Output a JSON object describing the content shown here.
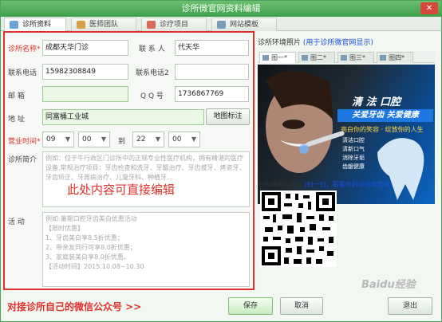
{
  "window": {
    "title": "诊所微官网资料编辑",
    "close_label": "✕"
  },
  "tabs": [
    {
      "label": "诊所资料",
      "active": true,
      "icon": "clinic-icon"
    },
    {
      "label": "医师团队",
      "active": false,
      "icon": "team-icon"
    },
    {
      "label": "诊疗项目",
      "active": false,
      "icon": "project-icon"
    },
    {
      "label": "网站模板",
      "active": false,
      "icon": "template-icon"
    }
  ],
  "form": {
    "clinic_name_label": "诊所名称*",
    "clinic_name_value": "成都天华门诊",
    "contact_label": "联 系 人",
    "contact_value": "代天华",
    "phone_label": "联系电话",
    "phone_value": "15982308849",
    "phone2_label": "联系电话2",
    "phone2_value": "",
    "mail_label": "邮    箱",
    "mail_value": "",
    "qq_label": "Q Q 号",
    "qq_value": "1736867769",
    "address_label": "地    址",
    "address_value": "同富桶工业城",
    "map_button": "地图标注",
    "hours_label": "营业时间*",
    "hour_start": "09",
    "min_start": "00",
    "to_label": "到",
    "hour_end": "22",
    "min_end": "00",
    "intro_label": "诊所简介",
    "intro_placeholder": "例如：位于牛行政区门诊所中的正规专业性医疗机构，拥有精湛的医疗设备,常规治疗项目：牙齿检查和洗牙、牙髓治疗、牙齿拔牙、烤瓷牙、牙齿矫正、牙周病治疗、儿童牙科、种植牙…",
    "overlay_note": "此处内容可直接编辑",
    "activity_label": "活    动",
    "activity_placeholder": "例如:暑期口腔牙齿美白优惠活动\n【限时优惠】\n1、牙齿美白享8.5折优惠；\n2、带亲友同行可享8.0折优惠；\n3、家庭装美白享8.0折优惠。\n【活动时间】2015.10.08~10.30"
  },
  "side": {
    "photos_label": "诊所环境照片",
    "photos_hint": "(用于诊所微官网显示)",
    "photo_tabs": [
      "图一*",
      "图二*",
      "图三*",
      "图四*"
    ],
    "banner_brand": "清 法 口腔",
    "banner_slogan": "关爱牙齿 关爱健康",
    "banner_sub": "亮白你的笑容 · 绽放你的人生",
    "banner_points": [
      "清洁口腔",
      "清新口气",
      "消除牙垢",
      "齿龈健康"
    ],
    "qr_label": "诊所微信二维码",
    "qr_hint": "(扫一扫，看看你的诊所微官网)"
  },
  "footer": {
    "link_text": "对接诊所自己的微信公众号 >>",
    "save": "保存",
    "cancel": "取消",
    "exit": "退出"
  },
  "watermark": "Baidu经验",
  "colors": {
    "accent_green": "#3e9f4a",
    "highlight_red": "#e0302a",
    "link_blue": "#1a4fd8"
  }
}
